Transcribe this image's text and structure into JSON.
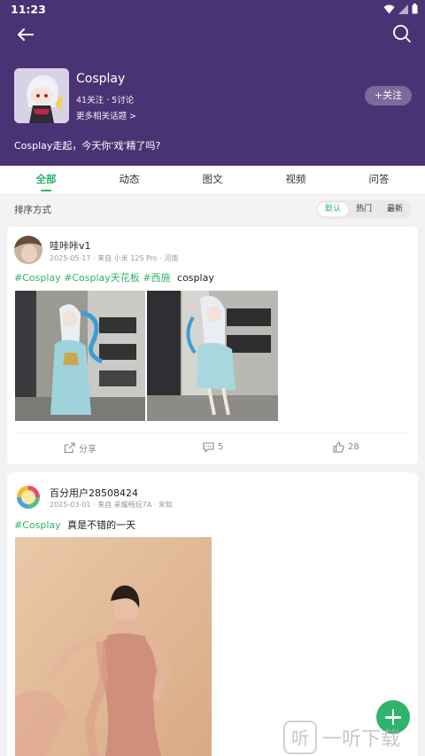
{
  "status": {
    "time": "11:23"
  },
  "topic": {
    "name": "Cosplay",
    "stats": "41关注 · 5讨论",
    "more_link": "更多相关话题 >",
    "follow_label": "+关注",
    "description": "Cosplay走起，今天你'戏'精了吗?"
  },
  "tabs": [
    "全部",
    "动态",
    "图文",
    "视频",
    "问答"
  ],
  "sort": {
    "label": "排序方式",
    "options": [
      "默认",
      "热门",
      "最新"
    ]
  },
  "posts": [
    {
      "user": "哇咔咔v1",
      "meta": "2025-05-17 · 来自 小米 12S Pro · 河南",
      "tags": [
        "#Cosplay",
        "#Cosplay天花板",
        "#西施"
      ],
      "text": "cosplay",
      "share_label": "分享",
      "comments": "5",
      "likes": "28"
    },
    {
      "user": "百分用户28508424",
      "meta": "2025-03-01 · 来自 采耀畅玩7A · 未知",
      "tags": [
        "#Cosplay"
      ],
      "text": "真是不错的一天"
    }
  ],
  "watermark": {
    "icon_char": "听",
    "text": "一听下载"
  },
  "colors": {
    "header": "#4a3374",
    "accent": "#2fb36d"
  },
  "icons": [
    "back-arrow-icon",
    "search-icon",
    "share-icon",
    "comment-icon",
    "like-icon",
    "add-icon"
  ]
}
